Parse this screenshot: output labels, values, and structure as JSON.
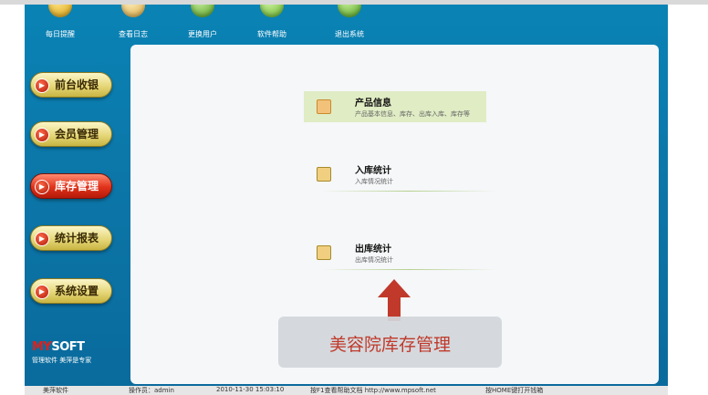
{
  "toolbar": {
    "items": [
      {
        "label": "每日提醒",
        "icon": "reminder-icon"
      },
      {
        "label": "查看日志",
        "icon": "log-icon"
      },
      {
        "label": "更换用户",
        "icon": "switch-user-icon"
      },
      {
        "label": "软件帮助",
        "icon": "help-icon"
      },
      {
        "label": "退出系统",
        "icon": "exit-icon"
      }
    ]
  },
  "sidebar": {
    "items": [
      {
        "label": "前台收银",
        "active": false
      },
      {
        "label": "会员管理",
        "active": false
      },
      {
        "label": "库存管理",
        "active": true
      },
      {
        "label": "统计报表",
        "active": false
      },
      {
        "label": "系统设置",
        "active": false
      }
    ]
  },
  "brand": {
    "logo_red": "MY",
    "logo_white": "SOFT",
    "slogan": "管理软件  美萍是专家"
  },
  "content": {
    "entries": [
      {
        "title": "产品信息",
        "desc": "产品基本信息、库存、出库入库、库存等",
        "icon": "product-info-icon",
        "highlighted": true
      },
      {
        "title": "入库统计",
        "desc": "入库情况统计",
        "icon": "stock-in-icon",
        "highlighted": false
      },
      {
        "title": "出库统计",
        "desc": "出库情况统计",
        "icon": "stock-out-icon",
        "highlighted": false
      }
    ]
  },
  "overlay": {
    "title": "美容院库存管理"
  },
  "statusbar": {
    "company": "美萍软件",
    "operator": "操作员：admin",
    "datetime": "2010-11-30 15:03:10",
    "help": "按F1查看帮助文档  http://www.mpsoft.net",
    "hint": "按HOME键打开钱箱"
  },
  "colors": {
    "app_bg": "#0a83b5",
    "active_button": "#e0321a",
    "button_gold": "#e6d77a",
    "arrow_red": "#c0392b",
    "highlight_bg": "#e0ecc4"
  }
}
